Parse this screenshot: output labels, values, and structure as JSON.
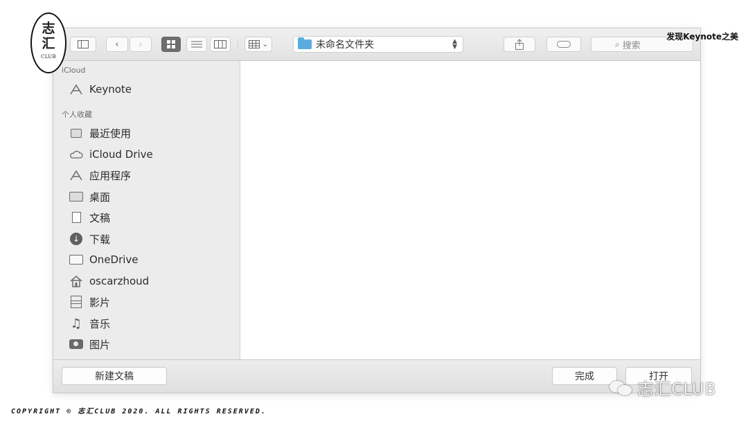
{
  "logo": {
    "line1": "志",
    "line2": "汇",
    "line3": "CLUB"
  },
  "caption": "发现Keynote之美",
  "toolbar": {
    "path_folder": "未命名文件夹",
    "search_placeholder": "搜索"
  },
  "sidebar": {
    "section_icloud": "iCloud",
    "section_favorites": "个人收藏",
    "icloud_items": [
      {
        "label": "Keynote",
        "icon": "keynote-app-icon"
      }
    ],
    "favorite_items": [
      {
        "label": "最近使用",
        "icon": "recents-icon"
      },
      {
        "label": "iCloud Drive",
        "icon": "cloud-icon"
      },
      {
        "label": "应用程序",
        "icon": "applications-icon"
      },
      {
        "label": "桌面",
        "icon": "desktop-icon"
      },
      {
        "label": "文稿",
        "icon": "documents-icon"
      },
      {
        "label": "下载",
        "icon": "download-icon"
      },
      {
        "label": "OneDrive",
        "icon": "folder-icon"
      },
      {
        "label": "oscarzhoud",
        "icon": "home-icon"
      },
      {
        "label": "影片",
        "icon": "movies-icon"
      },
      {
        "label": "音乐",
        "icon": "music-icon"
      },
      {
        "label": "图片",
        "icon": "pictures-icon"
      }
    ]
  },
  "bottom": {
    "new_document": "新建文稿",
    "done": "完成",
    "open": "打开"
  },
  "watermark": "志汇CLUB",
  "copyright": "COPYRIGHT © 志汇CLUB 2020. ALL RIGHTS RESERVED."
}
